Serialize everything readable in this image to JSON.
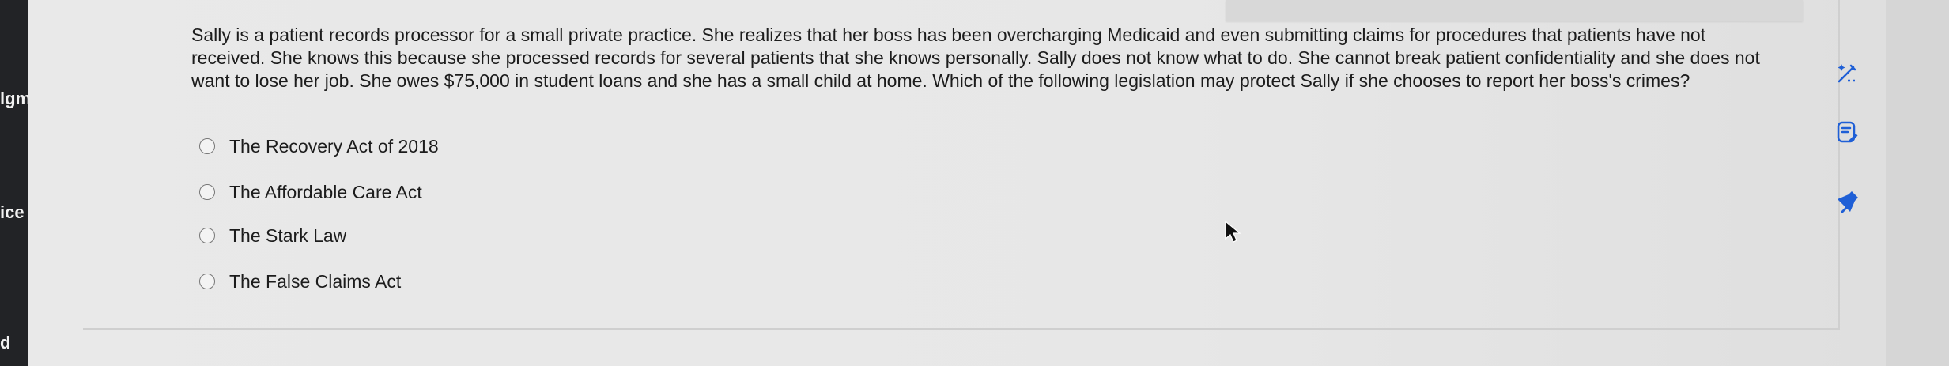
{
  "sidebar": {
    "items": [
      {
        "label": "lgmt"
      },
      {
        "label": "ice"
      },
      {
        "label": "d"
      }
    ]
  },
  "question": {
    "text": "Sally is a patient records processor for a small private practice. She realizes that her boss has been overcharging Medicaid and even submitting claims for procedures that patients have not received. She knows this because she processed records for several patients that she knows personally. Sally does not know what to do. She cannot break patient confidentiality and she does not want to lose her job. She owes $75,000 in student loans and she has a small child at home. Which of the following legislation may protect Sally if she chooses to report her boss's crimes?"
  },
  "options": [
    {
      "label": "The Recovery Act of 2018"
    },
    {
      "label": "The Affordable Care Act"
    },
    {
      "label": "The Stark Law"
    },
    {
      "label": "The False Claims Act"
    }
  ],
  "tools": [
    {
      "icon": "magic-pen-icon"
    },
    {
      "icon": "notes-edit-icon"
    },
    {
      "icon": "pin-icon"
    }
  ],
  "colors": {
    "sidebar_bg": "#222326",
    "accent_blue": "#1f5fd6",
    "text": "#1c1c1c"
  }
}
